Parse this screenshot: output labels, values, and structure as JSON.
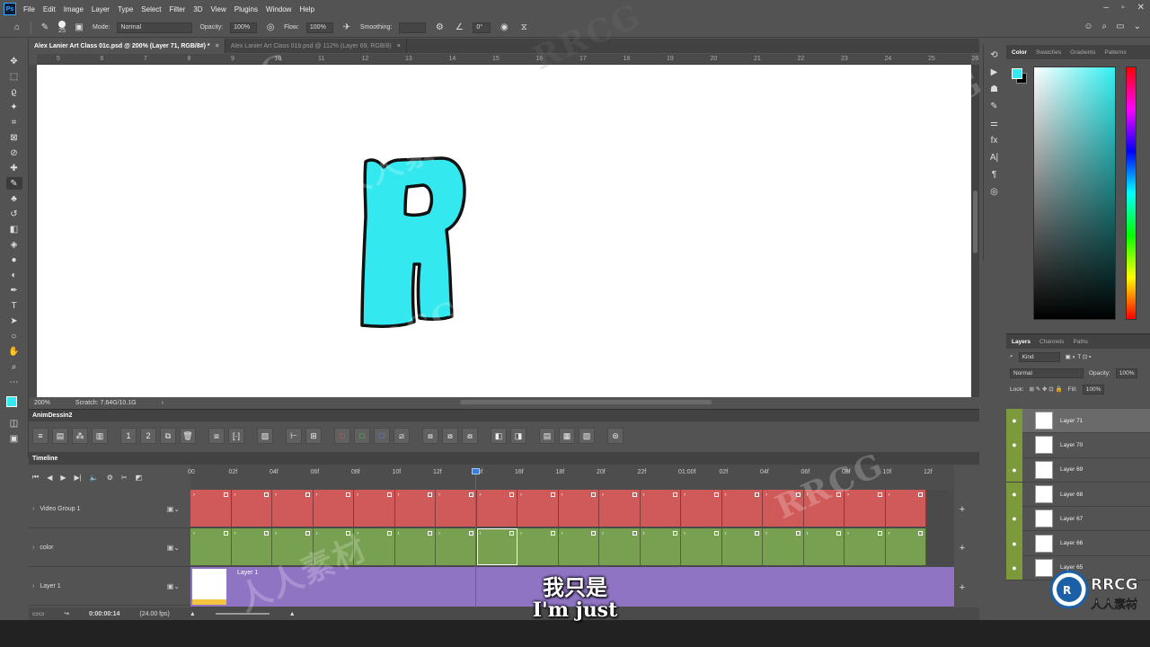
{
  "menubar": {
    "app_logo": "Ps",
    "items": [
      "File",
      "Edit",
      "Image",
      "Layer",
      "Type",
      "Select",
      "Filter",
      "3D",
      "View",
      "Plugins",
      "Window",
      "Help"
    ]
  },
  "options_bar": {
    "brush_size": "25",
    "mode_label": "Mode:",
    "mode_value": "Normal",
    "opacity_label": "Opacity:",
    "opacity_value": "100%",
    "flow_label": "Flow:",
    "flow_value": "100%",
    "smoothing_label": "Smoothing:",
    "angle_value": "0°"
  },
  "doc_tabs": [
    {
      "label": "Alex Lanier Art Class 01c.psd @ 200% (Layer 71, RGB/8#) *",
      "active": true
    },
    {
      "label": "Alex Lanier Art Class 01b.psd @ 112% (Layer 69, RGB/8)",
      "active": false
    }
  ],
  "ruler_ticks": [
    "5",
    "6",
    "7",
    "8",
    "9",
    "10",
    "11",
    "12",
    "13",
    "14",
    "15",
    "16",
    "17",
    "18",
    "19",
    "20",
    "21",
    "22",
    "23",
    "24",
    "25",
    "26"
  ],
  "status": {
    "zoom": "200%",
    "scratch": "Scratch: 7.64G/10.1G",
    "arrow": "›"
  },
  "anim_panel": {
    "title": "AnimDessin2"
  },
  "timeline": {
    "title": "Timeline",
    "ticks": [
      "00",
      "02f",
      "04f",
      "06f",
      "08f",
      "10f",
      "12f",
      "14f",
      "16f",
      "18f",
      "20f",
      "22f",
      "01:00f",
      "02f",
      "04f",
      "06f",
      "08f",
      "10f",
      "12f"
    ],
    "layers": [
      {
        "name": "Video Group 1"
      },
      {
        "name": "color"
      },
      {
        "name": "Layer 1"
      }
    ],
    "layer1_clip_label": "Layer 1",
    "timecode": "0:00:00:14",
    "fps": "(24.00 fps)",
    "colors": {
      "video_group": "#d05a5a",
      "color_track": "#77a050",
      "layer1_track": "#9074c4",
      "playhead": "#e33333"
    }
  },
  "color_panel": {
    "tabs": [
      "Color",
      "Swatches",
      "Gradients",
      "Patterns"
    ],
    "foreground": "#33e8ee",
    "background": "#000000"
  },
  "layers_panel": {
    "tabs": [
      "Layers",
      "Channels",
      "Paths"
    ],
    "kind_label": "Kind",
    "blend_mode": "Normal",
    "opacity_label": "Opacity:",
    "opacity_value": "100%",
    "lock_label": "Lock:",
    "fill_label": "Fill:",
    "fill_value": "100%",
    "layers": [
      "Layer 71",
      "Layer 70",
      "Layer 69",
      "Layer 68",
      "Layer 67",
      "Layer 66",
      "Layer 65"
    ]
  },
  "subtitles": {
    "chinese": "我只是",
    "english": "I'm just"
  },
  "canvas": {
    "letter_fill": "#33e8ee",
    "letter_stroke": "#111111"
  },
  "watermark": {
    "text": "RRCG",
    "cn_text": "人人素材"
  }
}
